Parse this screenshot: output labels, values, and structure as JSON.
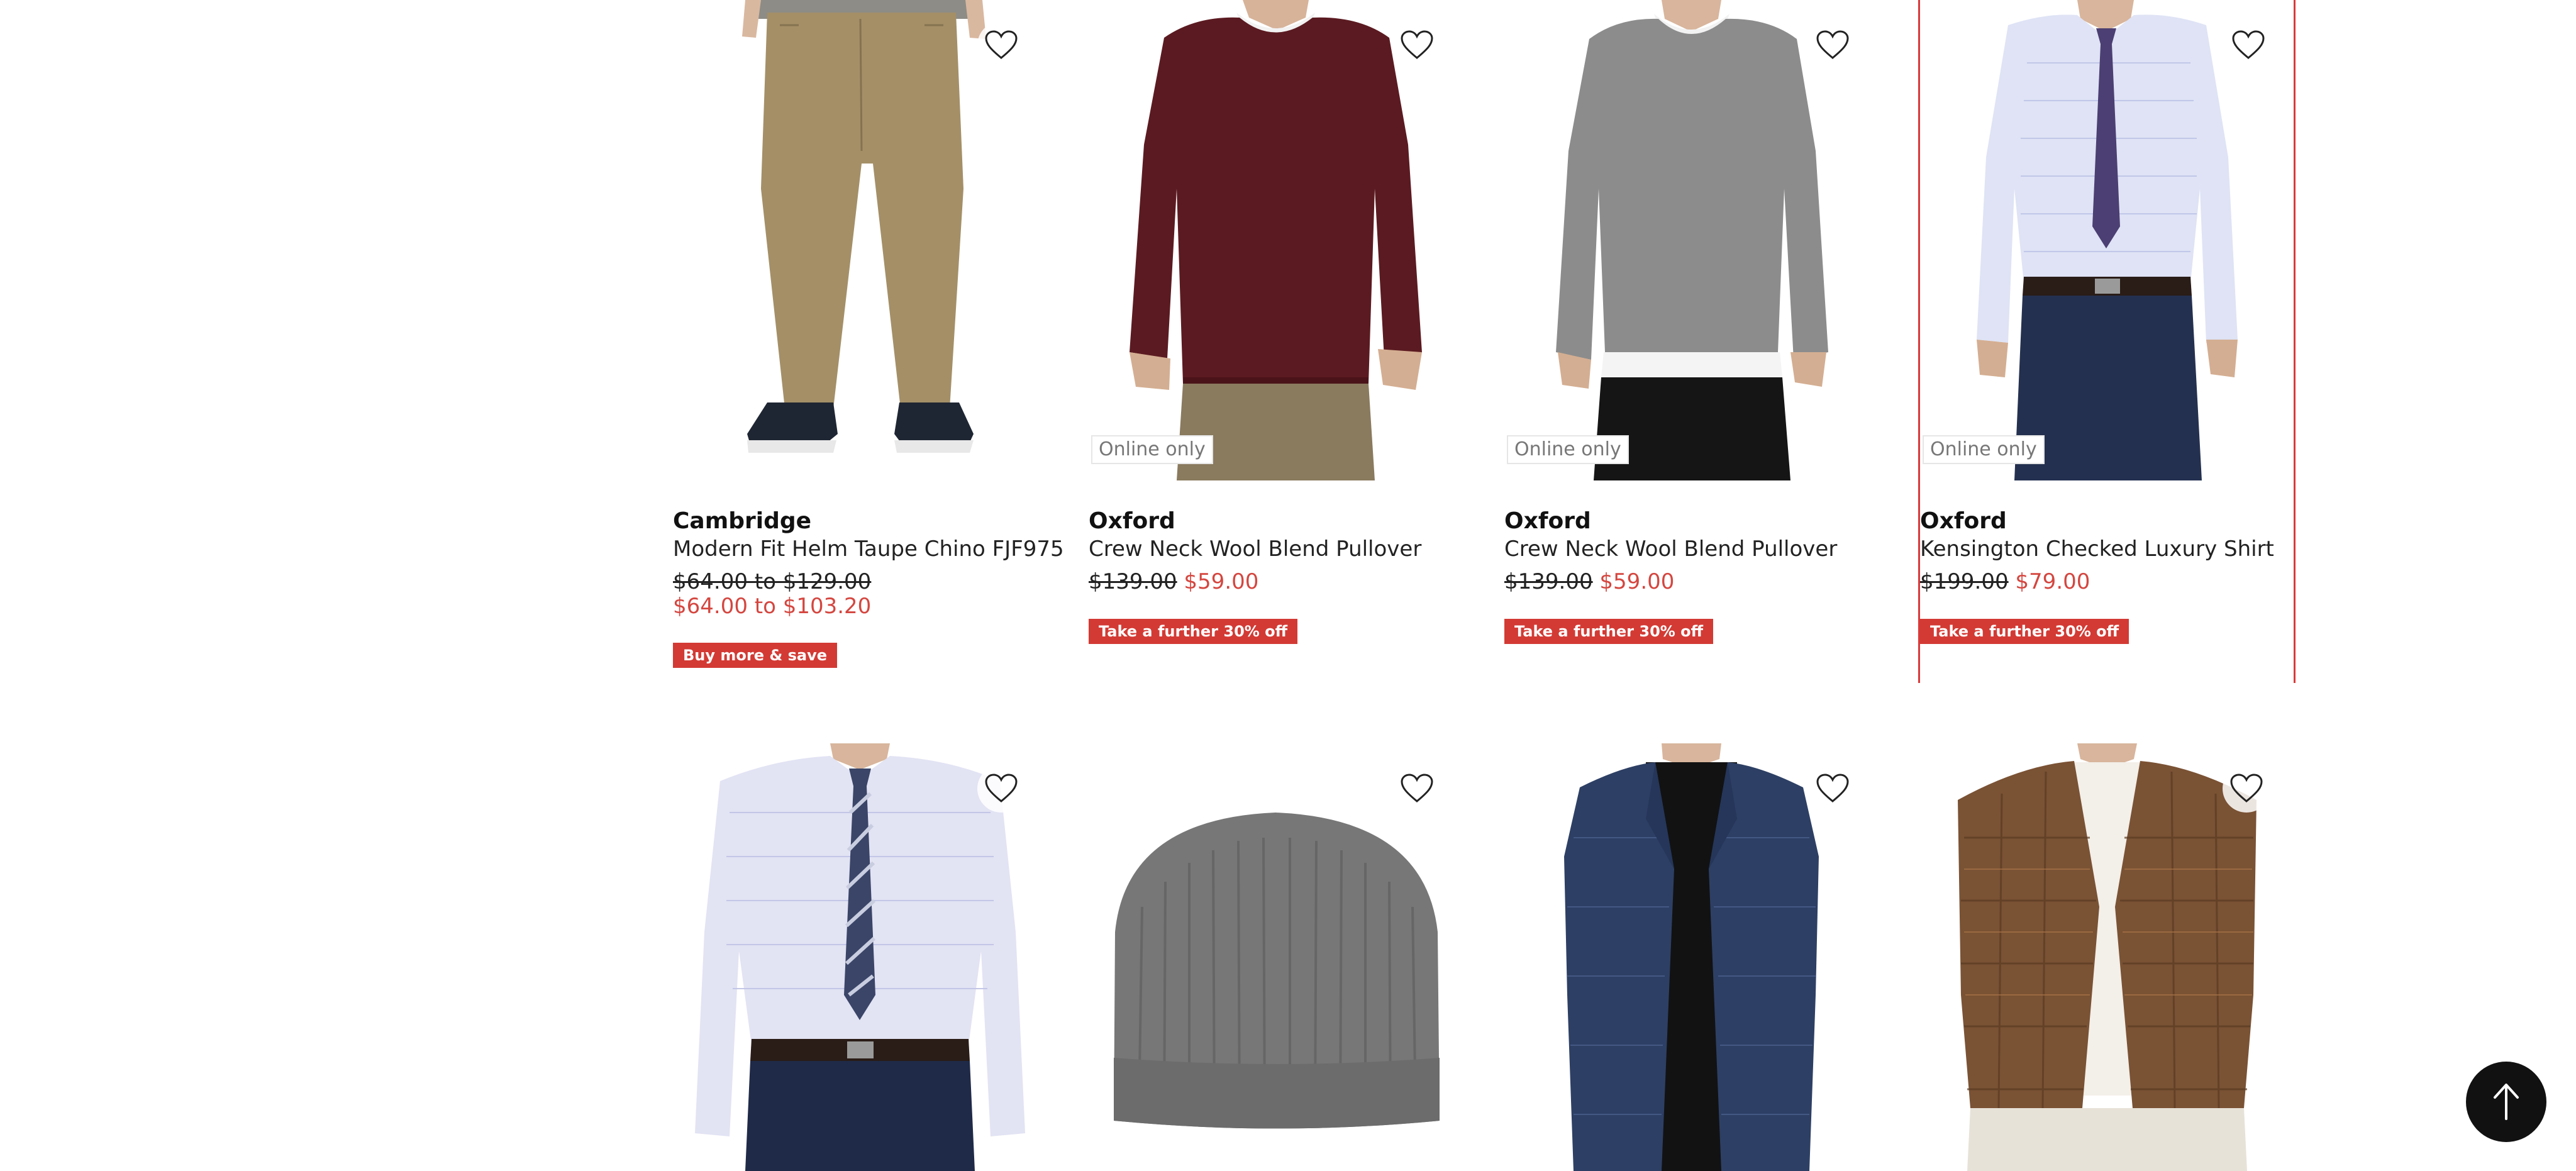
{
  "colors": {
    "accent": "#d33a34",
    "sale": "#d4463f",
    "selected_border": "#d93a3a"
  },
  "products_row1": [
    {
      "brand": "Cambridge",
      "name": "Modern Fit Helm Taupe Chino FJF975",
      "price_original": "$64.00 to $129.00",
      "price_sale": "$64.00 to $103.20",
      "promo": "Buy more & save",
      "online_only": ""
    },
    {
      "brand": "Oxford",
      "name": "Crew Neck Wool Blend Pullover",
      "price_original": "$139.00",
      "price_sale": "$59.00",
      "promo": "Take a further 30% off",
      "online_only": "Online only"
    },
    {
      "brand": "Oxford",
      "name": "Crew Neck Wool Blend Pullover",
      "price_original": "$139.00",
      "price_sale": "$59.00",
      "promo": "Take a further 30% off",
      "online_only": "Online only"
    },
    {
      "brand": "Oxford",
      "name": "Kensington Checked Luxury Shirt",
      "price_original": "$199.00",
      "price_sale": "$79.00",
      "promo": "Take a further 30% off",
      "online_only": "Online only"
    }
  ],
  "icons": {
    "wishlist": "heart-outline-icon",
    "back_to_top": "arrow-up-icon"
  }
}
